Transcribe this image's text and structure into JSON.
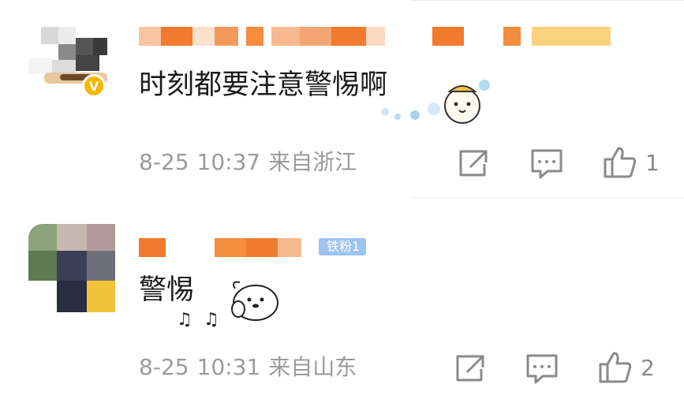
{
  "comments": [
    {
      "content": "时刻都要注意警惕啊",
      "date": "8-25",
      "time": "10:37",
      "location": "来自浙江",
      "likes": "1",
      "verified": true
    },
    {
      "content": "警惕",
      "date": "8-25",
      "time": "10:31",
      "location": "来自山东",
      "likes": "2",
      "fan_badge": "铁粉1"
    }
  ],
  "icons": {
    "share": "share-icon",
    "comment": "comment-icon",
    "like": "thumbs-up-icon",
    "verified": "verified-badge-icon"
  },
  "colors": {
    "meta_text": "#9b9b9b",
    "verified_badge": "#f5b700",
    "fan_badge": "#9ec3ee",
    "name_blur": "#f28a45"
  }
}
